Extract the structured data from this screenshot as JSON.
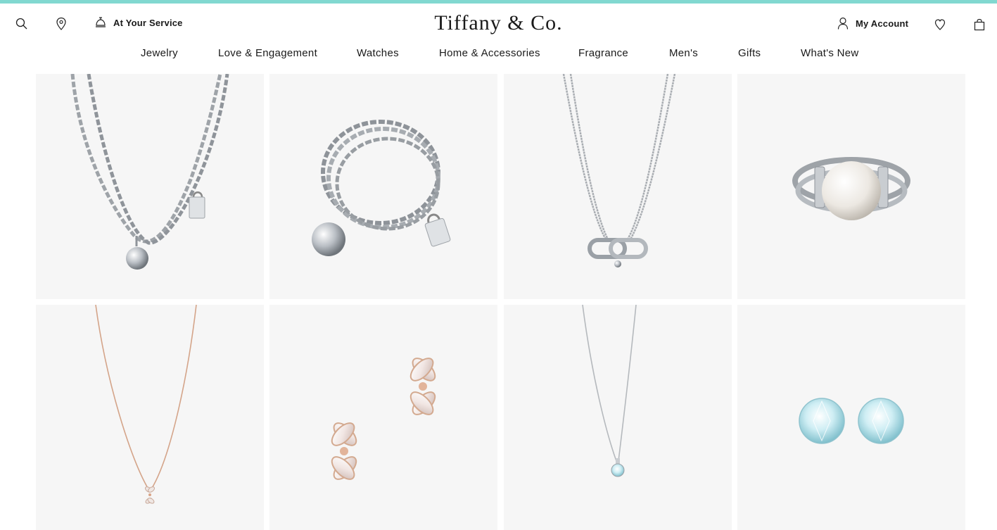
{
  "brand": {
    "logo_text": "Tiffany & Co.",
    "accent_color": "#81d8d0"
  },
  "utility": {
    "service_label": "At Your Service",
    "account_label": "My Account",
    "icons": [
      "search-icon",
      "location-pin-icon",
      "service-bell-icon",
      "user-icon",
      "heart-icon",
      "shopping-bag-icon"
    ]
  },
  "nav": {
    "items": [
      "Jewelry",
      "Love & Engagement",
      "Watches",
      "Home & Accessories",
      "Fragrance",
      "Men's",
      "Gifts",
      "What's New"
    ]
  },
  "products": [
    {
      "image": "silver-double-chain-necklace-with-lock-and-ball"
    },
    {
      "image": "silver-wrap-chain-bracelet-with-lock-and-ball"
    },
    {
      "image": "silver-double-chain-link-pendant-necklace"
    },
    {
      "image": "silver-pearl-ring"
    },
    {
      "image": "rose-gold-diamond-flower-pendant-necklace"
    },
    {
      "image": "rose-gold-diamond-flower-earrings"
    },
    {
      "image": "platinum-solitaire-diamond-pendant"
    },
    {
      "image": "round-diamond-stud-earrings"
    }
  ]
}
